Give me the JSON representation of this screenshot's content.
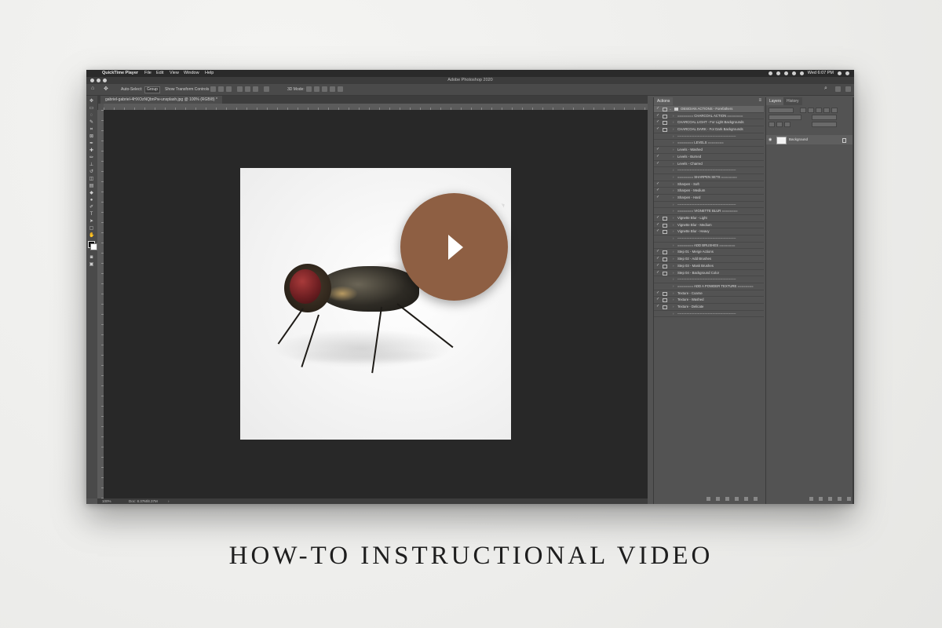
{
  "menubar": {
    "app": "QuickTime Player",
    "items": [
      "File",
      "Edit",
      "View",
      "Window",
      "Help"
    ],
    "clock": "Wed 6:07 PM"
  },
  "window": {
    "title": "Adobe Photoshop 2020"
  },
  "options_bar": {
    "auto_select_label": "Auto-Select:",
    "auto_select_value": "Group",
    "transform_label": "Show Transform Controls",
    "mode_label": "3D Mode:"
  },
  "document": {
    "tab_label": "gabriel-gabriel-4HXOzNQbnPw-unsplash.jpg @ 100% (RGB/8) *"
  },
  "status": {
    "zoom": "100%",
    "doc_info": "Doc: 8.37M/8.37M"
  },
  "actions_panel": {
    "tab": "Actions",
    "set_name": "OBSIDIAN ACTIONS - Forefathers",
    "rows": [
      {
        "label": "======== CHARCOAL ACTION ========",
        "check": "✓",
        "dialog": true
      },
      {
        "label": "CHARCOAL LIGHT - For Light Backgrounds",
        "check": "✓",
        "dialog": true
      },
      {
        "label": "CHARCOAL DARK - For Dark Backgrounds",
        "check": "✓",
        "dialog": true
      },
      {
        "label": "----------------------------------------------------",
        "check": "",
        "dialog": false
      },
      {
        "label": "======== LEVELS ========",
        "check": "",
        "dialog": false
      },
      {
        "label": "Levels - Washed",
        "check": "✓",
        "dialog": false
      },
      {
        "label": "Levels - Burned",
        "check": "✓",
        "dialog": false
      },
      {
        "label": "Levels - Charred",
        "check": "✓",
        "dialog": false
      },
      {
        "label": "----------------------------------------------------",
        "check": "",
        "dialog": false
      },
      {
        "label": "======== SHARPEN SETS ========",
        "check": "",
        "dialog": false
      },
      {
        "label": "Sharpen - Soft",
        "check": "✓",
        "dialog": false
      },
      {
        "label": "Sharpen - Medium",
        "check": "✓",
        "dialog": false
      },
      {
        "label": "Sharpen - Hard",
        "check": "✓",
        "dialog": false
      },
      {
        "label": "----------------------------------------------------",
        "check": "",
        "dialog": false
      },
      {
        "label": "======== VIGNETTE BLUR ========",
        "check": "",
        "dialog": false
      },
      {
        "label": "Vignette Blur - Light",
        "check": "✓",
        "dialog": true
      },
      {
        "label": "Vignette Blur - Medium",
        "check": "✓",
        "dialog": true
      },
      {
        "label": "Vignette Blur - Heavy",
        "check": "✓",
        "dialog": true
      },
      {
        "label": "----------------------------------------------------",
        "check": "",
        "dialog": false
      },
      {
        "label": "======== ADD BRUSHES ========",
        "check": "",
        "dialog": false
      },
      {
        "label": "Step 01 - Merge Actions",
        "check": "✓",
        "dialog": true
      },
      {
        "label": "Step 02 - Add Brushes",
        "check": "✓",
        "dialog": true
      },
      {
        "label": "Step 03 - Mask Brushes",
        "check": "✓",
        "dialog": true
      },
      {
        "label": "Step 04 - Background Color",
        "check": "✓",
        "dialog": true
      },
      {
        "label": "----------------------------------------------------",
        "check": "",
        "dialog": false
      },
      {
        "label": "======== ADD A POWDER TEXTURE ========",
        "check": "",
        "dialog": false
      },
      {
        "label": "Texture - Coarse",
        "check": "✓",
        "dialog": true
      },
      {
        "label": "Texture - Washed",
        "check": "✓",
        "dialog": true
      },
      {
        "label": "Texture - Delicate",
        "check": "✓",
        "dialog": true
      },
      {
        "label": "----------------------------------------------------",
        "check": "",
        "dialog": false
      }
    ]
  },
  "layers_panel": {
    "tabs": [
      "Layers",
      "History"
    ],
    "layer_name": "Background"
  },
  "headline": "HOW-TO INSTRUCTIONAL VIDEO",
  "colors": {
    "play_button": "#8e5f43",
    "canvas": "#282828"
  }
}
